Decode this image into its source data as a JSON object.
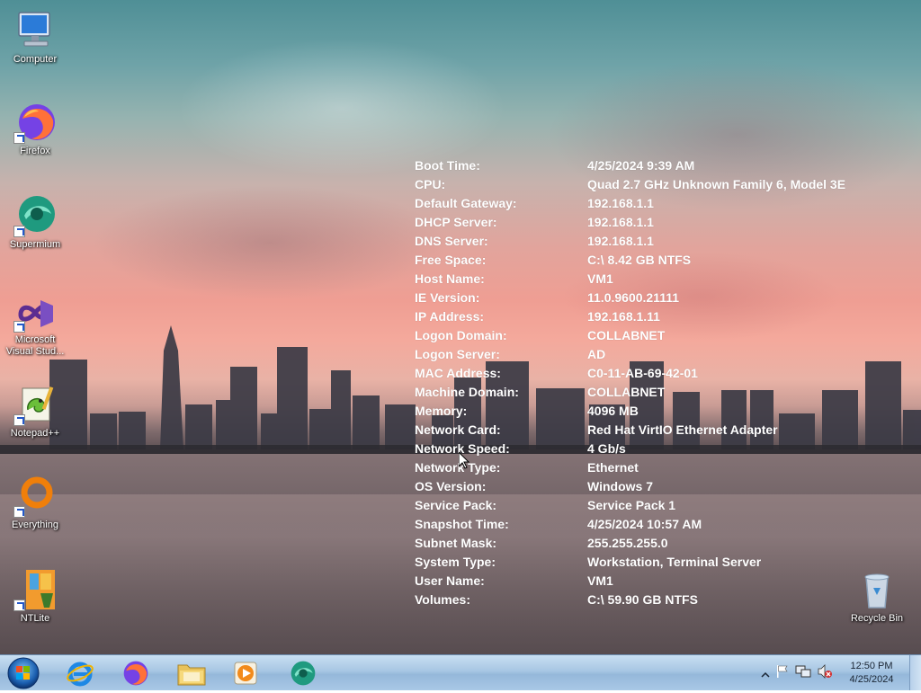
{
  "desktop": {
    "icons": [
      {
        "label": "Computer",
        "icon": "computer-icon"
      },
      {
        "label": "Firefox",
        "icon": "firefox-icon"
      },
      {
        "label": "Supermium",
        "icon": "supermium-icon"
      },
      {
        "label": "Microsoft Visual Stud...",
        "icon": "visual-studio-icon"
      },
      {
        "label": "Notepad++",
        "icon": "notepad-plus-plus-icon"
      },
      {
        "label": "Everything",
        "icon": "everything-search-icon"
      },
      {
        "label": "NTLite",
        "icon": "ntlite-icon"
      },
      {
        "label": "Recycle Bin",
        "icon": "recycle-bin-icon"
      }
    ]
  },
  "bginfo": [
    {
      "label": "Boot Time:",
      "value": "4/25/2024 9:39 AM"
    },
    {
      "label": "CPU:",
      "value": "Quad 2.7 GHz Unknown Family 6, Model 3E"
    },
    {
      "label": "Default Gateway:",
      "value": "192.168.1.1"
    },
    {
      "label": "DHCP Server:",
      "value": "192.168.1.1"
    },
    {
      "label": "DNS Server:",
      "value": "192.168.1.1"
    },
    {
      "label": "Free Space:",
      "value": "C:\\ 8.42 GB NTFS"
    },
    {
      "label": "Host Name:",
      "value": "VM1"
    },
    {
      "label": "IE Version:",
      "value": "11.0.9600.21111"
    },
    {
      "label": "IP Address:",
      "value": "192.168.1.11"
    },
    {
      "label": "Logon Domain:",
      "value": "COLLABNET"
    },
    {
      "label": "Logon Server:",
      "value": "AD"
    },
    {
      "label": "MAC Address:",
      "value": "C0-11-AB-69-42-01"
    },
    {
      "label": "Machine Domain:",
      "value": "COLLABNET"
    },
    {
      "label": "Memory:",
      "value": "4096 MB"
    },
    {
      "label": "Network Card:",
      "value": "Red Hat VirtIO Ethernet Adapter"
    },
    {
      "label": "Network Speed:",
      "value": "4 Gb/s"
    },
    {
      "label": "Network Type:",
      "value": "Ethernet"
    },
    {
      "label": "OS Version:",
      "value": "Windows 7"
    },
    {
      "label": "Service Pack:",
      "value": "Service Pack 1"
    },
    {
      "label": "Snapshot Time:",
      "value": "4/25/2024 10:57 AM"
    },
    {
      "label": "Subnet Mask:",
      "value": "255.255.255.0"
    },
    {
      "label": "System Type:",
      "value": "Workstation, Terminal Server"
    },
    {
      "label": "User Name:",
      "value": "VM1"
    },
    {
      "label": "Volumes:",
      "value": "C:\\ 59.90 GB NTFS"
    }
  ],
  "taskbar": {
    "start_icon": "windows-start-orb-icon",
    "pinned": [
      {
        "name": "internet-explorer",
        "icon": "internet-explorer-icon"
      },
      {
        "name": "firefox",
        "icon": "firefox-icon"
      },
      {
        "name": "file-explorer",
        "icon": "folder-icon"
      },
      {
        "name": "media-player",
        "icon": "media-player-icon"
      },
      {
        "name": "supermium",
        "icon": "supermium-icon"
      }
    ],
    "tray_icons": [
      "show-hidden-icons-chevron-icon",
      "action-center-flag-icon",
      "network-icon",
      "volume-muted-icon"
    ],
    "time": "12:50 PM",
    "date": "4/25/2024"
  },
  "colors": {
    "taskbar": "#a7c6e3",
    "bginfo_text": "#ffffff"
  }
}
